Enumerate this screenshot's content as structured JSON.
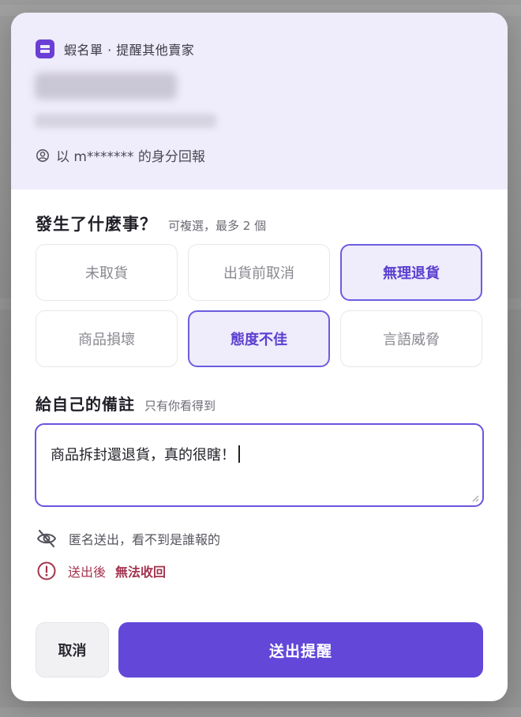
{
  "header": {
    "brand_text": "蝦名單 · 提醒其他賣家",
    "reporter_text": "以 m******* 的身分回報"
  },
  "question": {
    "title": "發生了什麼事？",
    "hint": "可複選，最多 2 個",
    "options": [
      {
        "label": "未取貨",
        "selected": false
      },
      {
        "label": "出貨前取消",
        "selected": false
      },
      {
        "label": "無理退貨",
        "selected": true
      },
      {
        "label": "商品損壞",
        "selected": false
      },
      {
        "label": "態度不佳",
        "selected": true
      },
      {
        "label": "言語威脅",
        "selected": false
      }
    ]
  },
  "note": {
    "title": "給自己的備註",
    "hint": "只有你看得到",
    "value": "商品拆封還退貨，真的很瞎！"
  },
  "notices": {
    "anonymous": "匿名送出，看不到是誰報的",
    "warning_prefix": "送出後",
    "warning_strong": "無法收回"
  },
  "actions": {
    "cancel_label": "取消",
    "submit_label": "送出提醒"
  },
  "colors": {
    "accent": "#6247d9",
    "header_bg": "#efecfb",
    "warning": "#a4334e"
  },
  "icons": {
    "brand": "list-icon",
    "reporter": "user-circle-icon",
    "anonymous": "eye-off-icon",
    "warning": "alert-circle-icon"
  }
}
